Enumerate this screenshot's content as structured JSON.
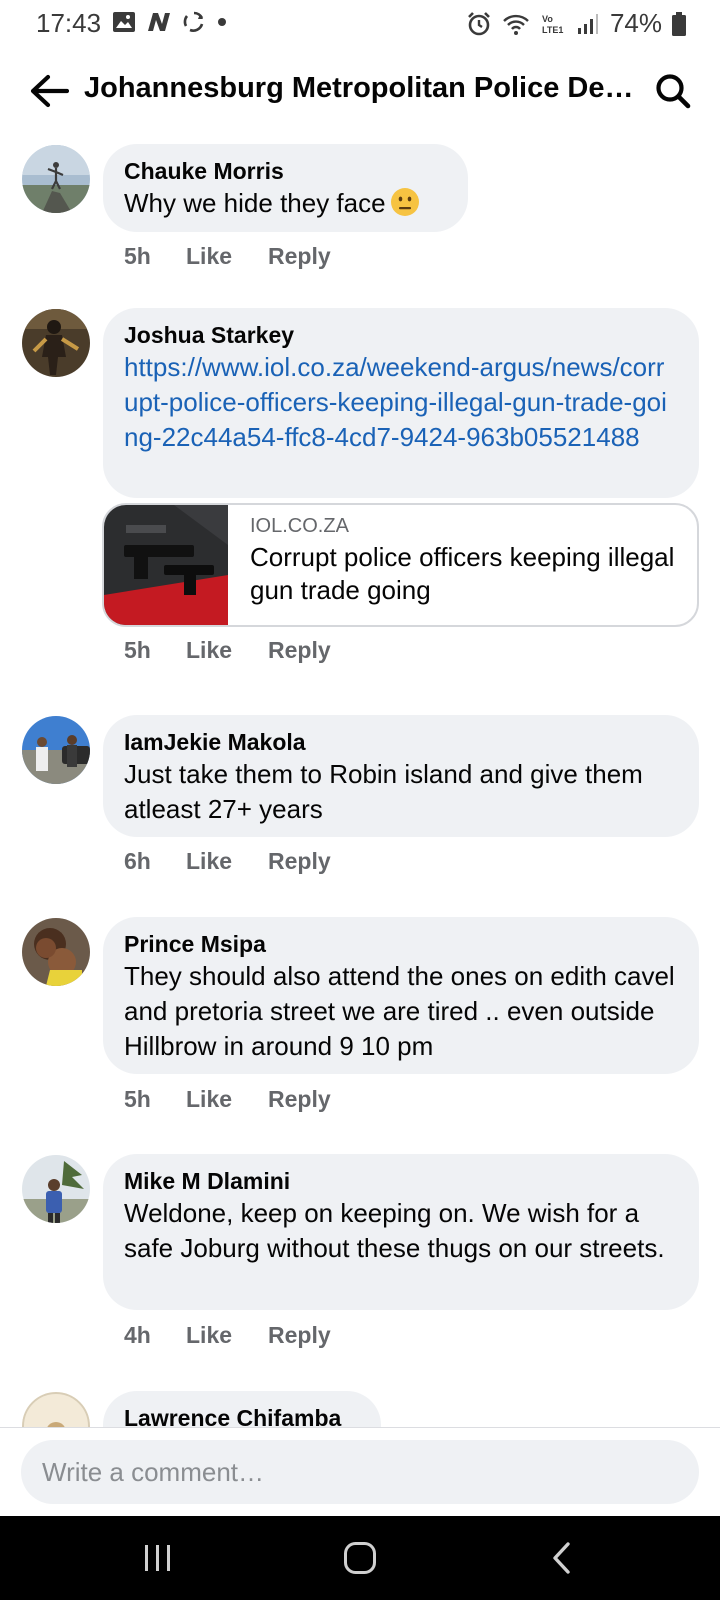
{
  "status_bar": {
    "time": "17:43",
    "battery": "74%",
    "left_icons": [
      "image-icon",
      "n-app-icon",
      "sync-icon",
      "dot-icon"
    ],
    "right_icons": [
      "alarm-icon",
      "wifi-icon",
      "volte-icon",
      "signal-icon",
      "battery-icon"
    ]
  },
  "header": {
    "title": "Johannesburg Metropolitan Police Dep...",
    "back_icon": "arrow-left-icon",
    "search_icon": "search-icon"
  },
  "comments": [
    {
      "author": "Chauke Morris",
      "text": "Why we hide they face",
      "time": "5h",
      "like": "Like",
      "reply": "Reply"
    },
    {
      "author": "Joshua Starkey",
      "text": "https://www.iol.co.za/weekend-argus/news/corrupt-police-officers-keeping-illegal-gun-trade-going-22c44a54-ffc8-4cd7-9424-963b05521488",
      "link_preview": {
        "domain": "IOL.CO.ZA",
        "title": "Corrupt police officers keeping illegal gun trade going"
      },
      "time": "5h",
      "like": "Like",
      "reply": "Reply"
    },
    {
      "author": "IamJekie Makola",
      "text": "Just take them to Robin island and give them atleast 27+ years",
      "time": "6h",
      "like": "Like",
      "reply": "Reply"
    },
    {
      "author": "Prince Msipa",
      "text": "They should also attend the ones on edith cavel and pretoria street we are tired .. even outside Hillbrow in around 9 10 pm",
      "time": "5h",
      "like": "Like",
      "reply": "Reply"
    },
    {
      "author": "Mike M Dlamini",
      "text": "Weldone, keep on keeping on. We wish for a safe Joburg without these thugs on our streets.",
      "time": "4h",
      "like": "Like",
      "reply": "Reply"
    },
    {
      "author": "Lawrence Chifamba"
    }
  ],
  "composer": {
    "placeholder": "Write a comment…"
  },
  "navbar": {
    "icons": [
      "recent-apps-icon",
      "home-icon",
      "back-icon"
    ]
  },
  "colors": {
    "bubble": "#eff1f4",
    "link": "#1a62b6",
    "meta": "#65676b",
    "text": "#050505"
  }
}
